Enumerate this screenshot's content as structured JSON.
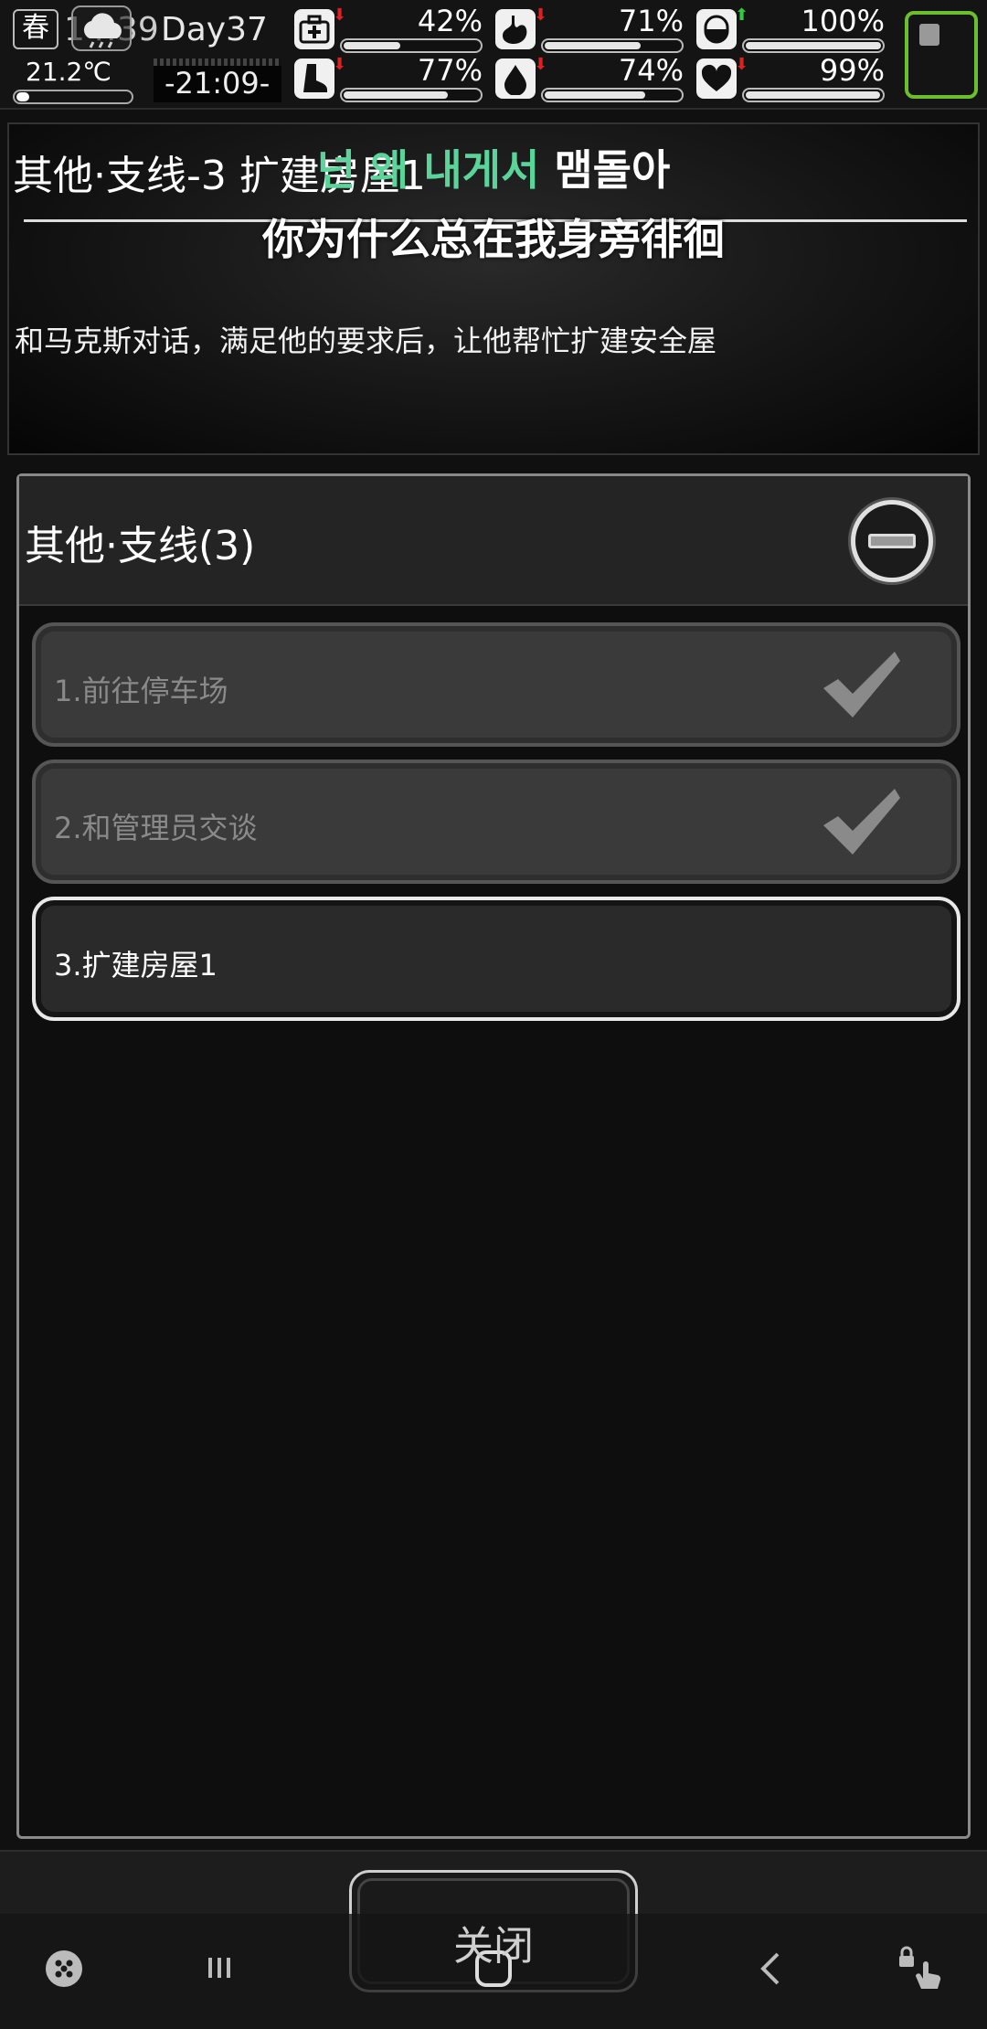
{
  "status": {
    "season": "春",
    "clock": "14:39",
    "day": "Day37",
    "temperature": "21.2℃",
    "countdown": "-21:09-",
    "stats": [
      {
        "id": "health",
        "icon": "medkit-icon",
        "percent": "42%",
        "level": 0.42,
        "trend": "down",
        "trend_color": "#e02020"
      },
      {
        "id": "hunger",
        "icon": "stomach-icon",
        "percent": "71%",
        "level": 0.71,
        "trend": "down",
        "trend_color": "#e02020"
      },
      {
        "id": "mood",
        "icon": "pill-icon",
        "percent": "100%",
        "level": 1.0,
        "trend": "up",
        "trend_color": "#2ecc40"
      },
      {
        "id": "stamina",
        "icon": "foot-icon",
        "percent": "77%",
        "level": 0.77,
        "trend": "down",
        "trend_color": "#e02020"
      },
      {
        "id": "thirst",
        "icon": "water-drop-icon",
        "percent": "74%",
        "level": 0.74,
        "trend": "down",
        "trend_color": "#e02020"
      },
      {
        "id": "heart",
        "icon": "heart-icon",
        "percent": "99%",
        "level": 0.99,
        "trend": "down",
        "trend_color": "#e02020"
      }
    ],
    "battery_color": "#6bbf2c"
  },
  "quest": {
    "title": "其他·支线-3 扩建房屋1",
    "description": "和马克斯对话，满足他的要求后，让他帮忙扩建安全屋"
  },
  "subtitle": {
    "korean_green": "넌 왜 내게서",
    "korean_white": " 맴돌아",
    "chinese": "你为什么总在我身旁徘徊"
  },
  "panel": {
    "title": "其他·支线(3)",
    "tasks": [
      {
        "label": "1.前往停车场",
        "status": "completed"
      },
      {
        "label": "2.和管理员交谈",
        "status": "completed"
      },
      {
        "label": "3.扩建房屋1",
        "status": "active"
      }
    ]
  },
  "close_button": "关闭",
  "navbar": [
    "game-icon",
    "recent-apps-icon",
    "home-icon",
    "back-icon",
    "touch-lock-icon"
  ]
}
